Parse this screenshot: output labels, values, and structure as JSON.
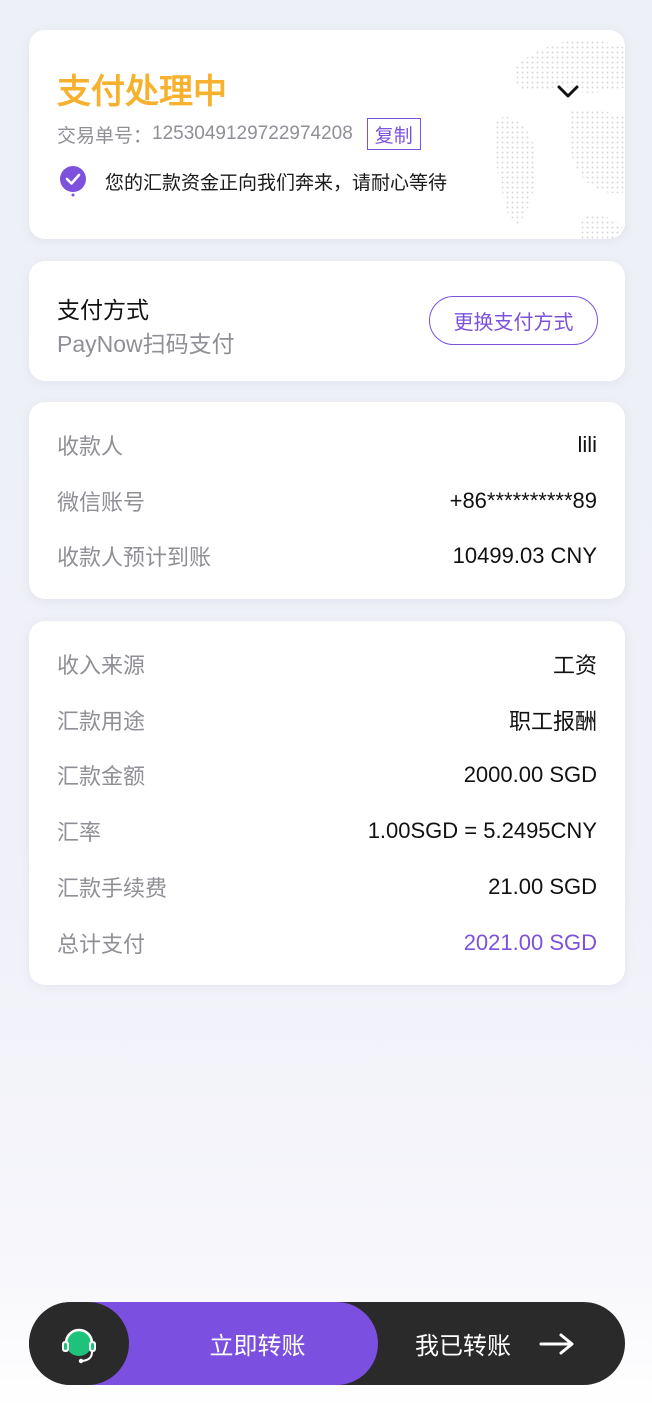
{
  "status": {
    "title": "支付处理中",
    "order_label": "交易单号：",
    "order_number": "1253049129722974208",
    "copy_label": "复制",
    "notice": "您的汇款资金正向我们奔来，请耐心等待",
    "title_color": "#f6b12f",
    "accent_color": "#7c52dd"
  },
  "payment": {
    "title": "支付方式",
    "method": "PayNow扫码支付",
    "change_label": "更换支付方式"
  },
  "payee": {
    "rows": [
      {
        "label": "收款人",
        "value": "lili"
      },
      {
        "label": "微信账号",
        "value": "+86**********89"
      },
      {
        "label": "收款人预计到账",
        "value": "10499.03 CNY"
      }
    ]
  },
  "details": {
    "rows": [
      {
        "label": "收入来源",
        "value": "工资"
      },
      {
        "label": "汇款用途",
        "value": "职工报酬"
      },
      {
        "label": "汇款金额",
        "value": "2000.00 SGD"
      },
      {
        "label": "汇率",
        "value": "1.00SGD = 5.2495CNY"
      },
      {
        "label": "汇款手续费",
        "value": "21.00 SGD"
      },
      {
        "label": "总计支付",
        "value": "2021.00 SGD"
      }
    ]
  },
  "bottom_bar": {
    "transfer_now_label": "立即转账",
    "transferred_label": "我已转账",
    "cs_icon": "customer-service-headset-icon",
    "arrow_icon": "arrow-right-icon",
    "primary_color": "#7b4fe0",
    "dark_color": "#2a2a2a",
    "cs_color": "#1fc27a"
  }
}
